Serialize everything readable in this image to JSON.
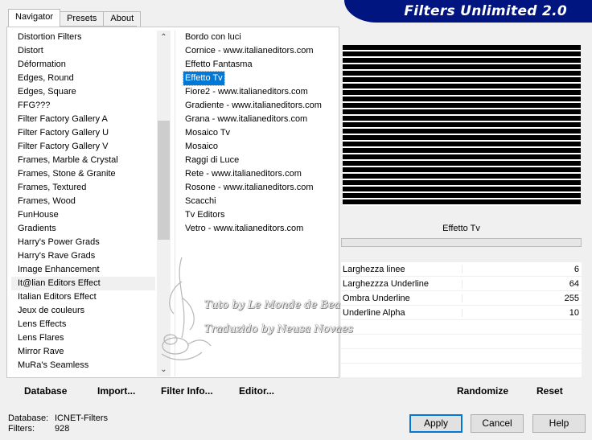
{
  "tabs": [
    {
      "label": "Navigator",
      "active": true
    },
    {
      "label": "Presets",
      "active": false
    },
    {
      "label": "About",
      "active": false
    }
  ],
  "banner": {
    "title": "Filters Unlimited 2.0",
    "color": "#00157f"
  },
  "categories": [
    "Distortion Filters",
    "Distort",
    "Déformation",
    "Edges, Round",
    "Edges, Square",
    "FFG???",
    "Filter Factory Gallery A",
    "Filter Factory Gallery U",
    "Filter Factory Gallery V",
    "Frames, Marble & Crystal",
    "Frames, Stone & Granite",
    "Frames, Textured",
    "Frames, Wood",
    "FunHouse",
    "Gradients",
    "Harry's Power Grads",
    "Harry's Rave Grads",
    "Image Enhancement",
    "It@lian Editors Effect",
    "Italian Editors Effect",
    "Jeux de couleurs",
    "Lens Effects",
    "Lens Flares",
    "Mirror Rave",
    "MuRa's Seamless"
  ],
  "current_category": "It@lian Editors Effect",
  "filters": [
    "Bordo con luci",
    "Cornice - www.italianeditors.com",
    "Effetto Fantasma",
    "Effetto Tv",
    "Fiore2 - www.italianeditors.com",
    "Gradiente - www.italianeditors.com",
    "Grana - www.italianeditors.com",
    "Mosaico Tv",
    "Mosaico",
    "Raggi di Luce",
    "Rete - www.italianeditors.com",
    "Rosone - www.italianeditors.com",
    "Scacchi",
    "Tv Editors",
    "Vetro - www.italianeditors.com"
  ],
  "selected_filter": "Effetto Tv",
  "preview": {
    "filter_name": "Effetto Tv"
  },
  "params": [
    {
      "label": "Larghezza linee",
      "value": "6"
    },
    {
      "label": "Larghezzza Underline",
      "value": "64"
    },
    {
      "label": "Ombra Underline",
      "value": "255"
    },
    {
      "label": "Underline Alpha",
      "value": "10"
    }
  ],
  "bottom_buttons": {
    "database": "Database",
    "import": "Import...",
    "filter_info": "Filter Info...",
    "editor": "Editor...",
    "randomize": "Randomize",
    "reset": "Reset"
  },
  "footer": {
    "database_label": "Database:",
    "database_value": "ICNET-Filters",
    "filters_label": "Filters:",
    "filters_value": "928",
    "apply": "Apply",
    "cancel": "Cancel",
    "help": "Help"
  },
  "watermark": {
    "line1": "Tuto by Le Monde de Bea",
    "line2": "Traduzido by Neusa Novaes"
  },
  "colors": {
    "selection": "#0078d7",
    "banner": "#00157f"
  }
}
